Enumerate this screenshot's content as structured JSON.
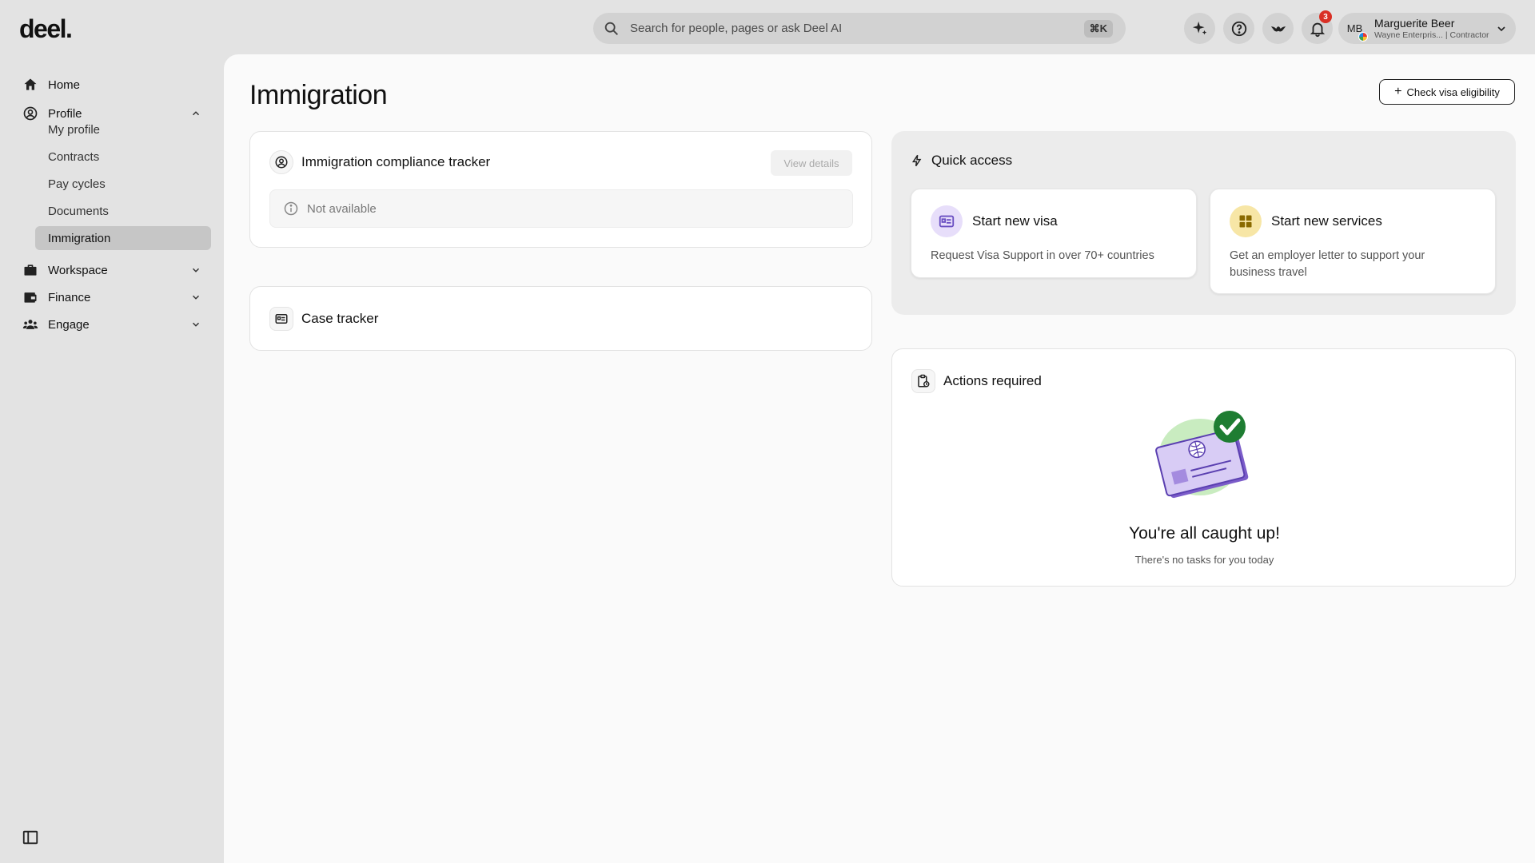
{
  "brand": {
    "logo": "deel."
  },
  "search": {
    "placeholder": "Search for people, pages or ask Deel AI",
    "shortcut": "⌘K"
  },
  "header": {
    "notification_count": "3",
    "user": {
      "initials": "MB",
      "name": "Marguerite Beer",
      "subtitle": "Wayne Enterpris... | Contractor"
    }
  },
  "sidebar": {
    "items": [
      {
        "label": "Home",
        "icon": "home-icon"
      },
      {
        "label": "Profile",
        "icon": "user-circle-icon",
        "expanded": true
      },
      {
        "label": "Workspace",
        "icon": "briefcase-icon",
        "expanded": false
      },
      {
        "label": "Finance",
        "icon": "wallet-icon",
        "expanded": false
      },
      {
        "label": "Engage",
        "icon": "people-icon",
        "expanded": false
      }
    ],
    "profile_sub": [
      {
        "label": "My profile"
      },
      {
        "label": "Contracts"
      },
      {
        "label": "Pay cycles"
      },
      {
        "label": "Documents"
      },
      {
        "label": "Immigration",
        "active": true
      }
    ]
  },
  "main": {
    "title": "Immigration",
    "check_visa_label": "Check visa eligibility",
    "compliance": {
      "title": "Immigration compliance tracker",
      "view_label": "View details",
      "status": "Not available"
    },
    "case_tracker": {
      "title": "Case tracker"
    },
    "quick_access": {
      "title": "Quick access",
      "cards": [
        {
          "title": "Start new visa",
          "desc": "Request Visa Support in over 70+ countries",
          "icon_color": "#e7defa"
        },
        {
          "title": "Start new services",
          "desc": "Get an employer letter to support your business travel",
          "icon_color": "#f7e6a6"
        }
      ]
    },
    "actions": {
      "title": "Actions required",
      "empty_title": "You're all caught up!",
      "empty_sub": "There's no tasks for you today"
    }
  }
}
